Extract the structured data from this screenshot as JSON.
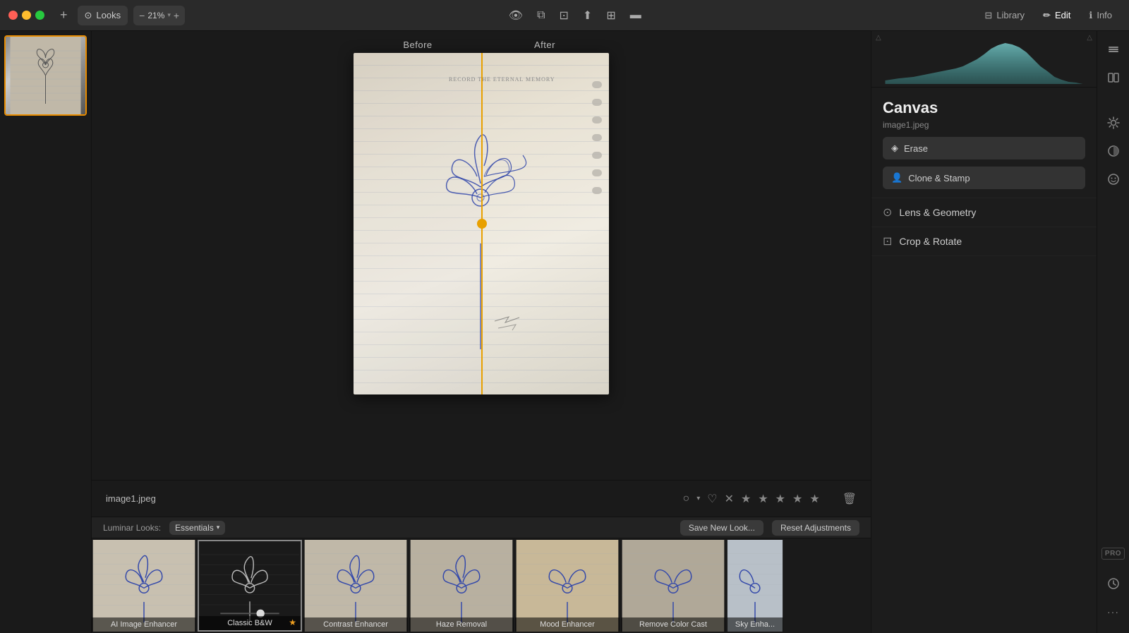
{
  "app": {
    "title": "Luminar",
    "traffic_lights": [
      "red",
      "yellow",
      "green"
    ]
  },
  "toolbar": {
    "add_btn": "+",
    "looks_label": "Looks",
    "zoom_value": "21%",
    "zoom_minus": "−",
    "zoom_plus": "+",
    "view_eye": "👁",
    "compare_btn": "⧉",
    "crop_btn": "⊡",
    "share_btn": "↑",
    "grid_btn": "⊞",
    "filmstrip_btn": "▬",
    "library_label": "Library",
    "edit_label": "Edit",
    "info_label": "Info"
  },
  "image": {
    "filename": "image1.jpeg",
    "before_label": "Before",
    "after_label": "After"
  },
  "canvas": {
    "title": "Canvas",
    "subtitle": "image1.jpeg",
    "erase_label": "Erase",
    "clone_stamp_label": "Clone & Stamp",
    "lens_geometry_label": "Lens & Geometry",
    "crop_rotate_label": "Crop & Rotate"
  },
  "looks": {
    "label": "Luminar Looks:",
    "dropdown": "Essentials",
    "save_new_look": "Save New Look...",
    "reset_adjustments": "Reset Adjustments"
  },
  "look_items": [
    {
      "id": 1,
      "label": "AI Image Enhancer",
      "bg": "look-bg-1",
      "selected": false
    },
    {
      "id": 2,
      "label": "Classic B&W",
      "bg": "look-bg-2",
      "selected": true,
      "starred": true
    },
    {
      "id": 3,
      "label": "Contrast Enhancer",
      "bg": "look-bg-3",
      "selected": false
    },
    {
      "id": 4,
      "label": "Haze Removal",
      "bg": "look-bg-4",
      "selected": false
    },
    {
      "id": 5,
      "label": "Mood Enhancer",
      "bg": "look-bg-5",
      "selected": false
    },
    {
      "id": 6,
      "label": "Remove Color Cast",
      "bg": "look-bg-6",
      "selected": false
    },
    {
      "id": 7,
      "label": "Sky Enhancer",
      "bg": "look-bg-7",
      "selected": false
    }
  ],
  "rating": {
    "stars": [
      false,
      false,
      false,
      false,
      false
    ]
  },
  "right_icons": {
    "layers": "⊞",
    "columns": "⊟",
    "sun": "☀",
    "palette": "◑",
    "face": "☺",
    "clock": "🕐",
    "more": "···",
    "pro": "PRO"
  }
}
